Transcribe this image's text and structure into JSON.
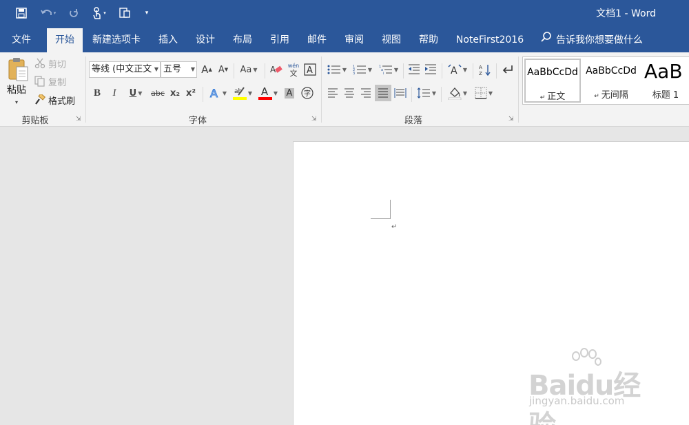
{
  "window": {
    "title": "文档1  -  Word"
  },
  "quick_access": {
    "save_icon": "save-icon",
    "undo_icon": "undo-icon",
    "redo_icon": "redo-icon",
    "touch_icon": "touch-mode-icon",
    "customize_icon": "customize-icon"
  },
  "tabs": [
    {
      "label": "文件"
    },
    {
      "label": "开始"
    },
    {
      "label": "新建选项卡"
    },
    {
      "label": "插入"
    },
    {
      "label": "设计"
    },
    {
      "label": "布局"
    },
    {
      "label": "引用"
    },
    {
      "label": "邮件"
    },
    {
      "label": "审阅"
    },
    {
      "label": "视图"
    },
    {
      "label": "帮助"
    },
    {
      "label": "NoteFirst2016"
    }
  ],
  "tell_me": "告诉我你想要做什么",
  "clipboard": {
    "group_label": "剪贴板",
    "paste": "粘贴",
    "cut": "剪切",
    "copy": "复制",
    "format_painter": "格式刷"
  },
  "font": {
    "group_label": "字体",
    "font_name": "等线 (中文正文",
    "font_size": "五号",
    "bold": "B",
    "italic": "I",
    "underline": "U",
    "strikethrough": "abc",
    "subscript": "x₂",
    "superscript": "x²",
    "change_case": "Aa",
    "grow": "A",
    "shrink": "A",
    "phonetic": "文",
    "font_color_label": "A",
    "char_shading": "A",
    "enclose": "字"
  },
  "paragraph": {
    "group_label": "段落"
  },
  "styles": {
    "items": [
      {
        "preview": "AaBbCcDd",
        "name": "正文"
      },
      {
        "preview": "AaBbCcDd",
        "name": "无间隔"
      },
      {
        "preview": "AaB",
        "name": "标题 1"
      }
    ]
  },
  "document": {
    "paragraph_mark": "↵"
  },
  "watermark": {
    "main": "Baidu经验",
    "sub": "jingyan.baidu.com"
  },
  "colors": {
    "brand": "#2b579a",
    "ribbon": "#f3f3f3",
    "highlight": "#ffff00",
    "font_color": "#ff0000"
  }
}
